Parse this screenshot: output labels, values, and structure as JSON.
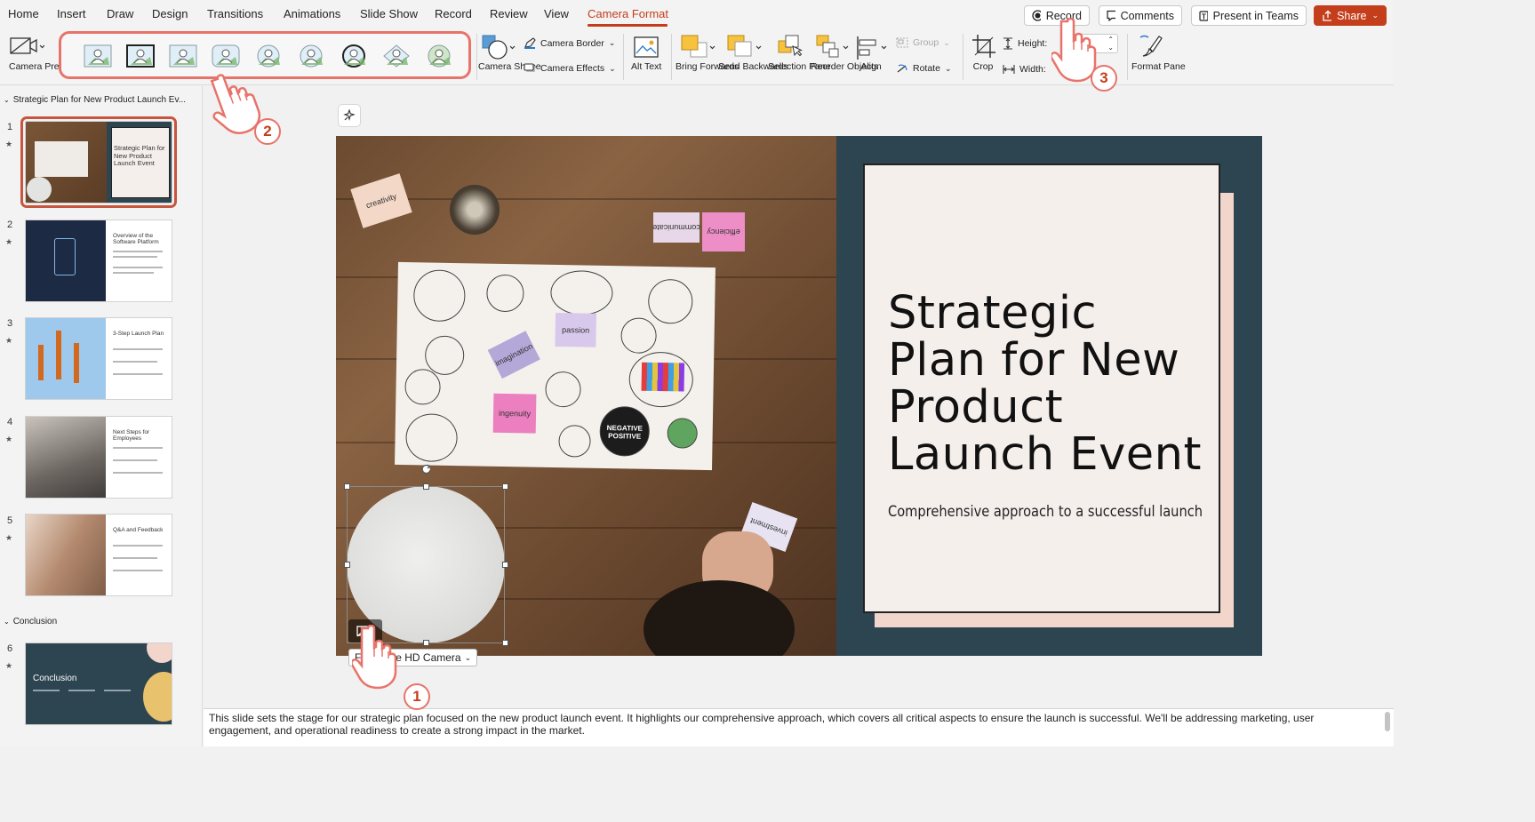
{
  "menu": {
    "tabs": [
      "Home",
      "Insert",
      "Draw",
      "Design",
      "Transitions",
      "Animations",
      "Slide Show",
      "Record",
      "Review",
      "View",
      "Camera Format"
    ],
    "active_tab": "Camera Format",
    "record_label": "Record",
    "comments_label": "Comments",
    "present_teams_label": "Present in Teams",
    "share_label": "Share"
  },
  "ribbon": {
    "camera_preview": "Camera Preview",
    "camera_shape": "Camera Shape",
    "camera_border": "Camera Border",
    "camera_effects": "Camera Effects",
    "alt_text": "Alt Text",
    "bring_forwards": "Bring Forwards",
    "send_backwards": "Send Backwards",
    "selection_pane": "Selection Pane",
    "reorder_objects": "Reorder Objects",
    "align": "Align",
    "group": "Group",
    "rotate": "Rotate",
    "crop": "Crop",
    "height": "Height:",
    "width": "Width:",
    "format_pane": "Format Pane",
    "styles_count": 9
  },
  "panel": {
    "section1": "Strategic Plan for New Product Launch Ev...",
    "section2": "Conclusion",
    "slides": [
      {
        "num": "1",
        "title": "Strategic Plan for New Product Launch Event"
      },
      {
        "num": "2",
        "title": "Overview of the Software Platform"
      },
      {
        "num": "3",
        "title": "3-Step Launch Plan"
      },
      {
        "num": "4",
        "title": "Next Steps for Employees"
      },
      {
        "num": "5",
        "title": "Q&A and Feedback"
      },
      {
        "num": "6",
        "title": "Conclusion"
      }
    ],
    "star": "★"
  },
  "slide": {
    "title": "Strategic Plan for New Product Launch Event",
    "subtitle": "Comprehensive approach to a successful launch",
    "stickies": [
      "creativity",
      "communicate",
      "efficiency",
      "passion",
      "imagination",
      "ingenuity",
      "investment",
      "NEGATIVE POSITIVE"
    ],
    "colors": {
      "teal": "#2d4451",
      "card": "#f5efec",
      "card_shadow": "#f2d6cc",
      "accent": "#c43e1c"
    }
  },
  "camera": {
    "dropdown_label": "FaceTime HD Camera"
  },
  "notes": {
    "text": "This slide sets the stage for our strategic plan focused on the new product launch event. It highlights our comprehensive approach, which covers all critical aspects to ensure the launch is successful. We'll be addressing marketing, user engagement, and operational readiness to create a strong impact in the market."
  },
  "annotations": {
    "badges": [
      "1",
      "2",
      "3"
    ]
  }
}
